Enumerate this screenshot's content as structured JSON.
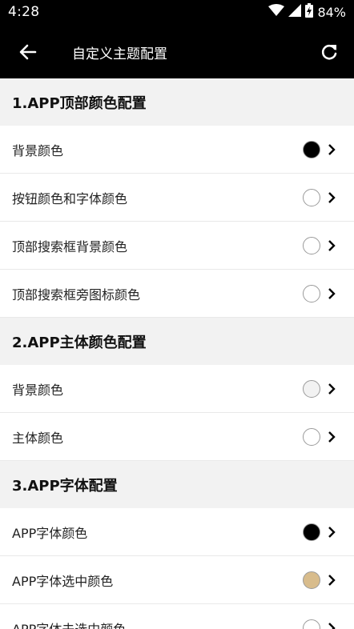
{
  "status_bar": {
    "time": "4:28",
    "battery": "84%",
    "icons": [
      "wifi-icon",
      "signal-icon",
      "battery-charging-icon"
    ]
  },
  "app_bar": {
    "title": "自定义主题配置",
    "back_icon": "arrow-left-icon",
    "refresh_icon": "refresh-icon"
  },
  "sections": [
    {
      "title": "1.APP顶部颜色配置",
      "items": [
        {
          "label": "背景颜色",
          "color": "#000000"
        },
        {
          "label": "按钮颜色和字体颜色",
          "color": "#ffffff"
        },
        {
          "label": "顶部搜索框背景颜色",
          "color": "#ffffff"
        },
        {
          "label": "顶部搜索框旁图标颜色",
          "color": "#ffffff"
        }
      ]
    },
    {
      "title": "2.APP主体颜色配置",
      "items": [
        {
          "label": "背景颜色",
          "color": "#f2f2f2"
        },
        {
          "label": "主体颜色",
          "color": "#ffffff"
        }
      ]
    },
    {
      "title": "3.APP字体配置",
      "items": [
        {
          "label": "APP字体颜色",
          "color": "#000000"
        },
        {
          "label": "APP字体选中颜色",
          "color": "#d8bc8c"
        },
        {
          "label": "APP字体未选中颜色",
          "color": "#ffffff"
        }
      ]
    }
  ]
}
